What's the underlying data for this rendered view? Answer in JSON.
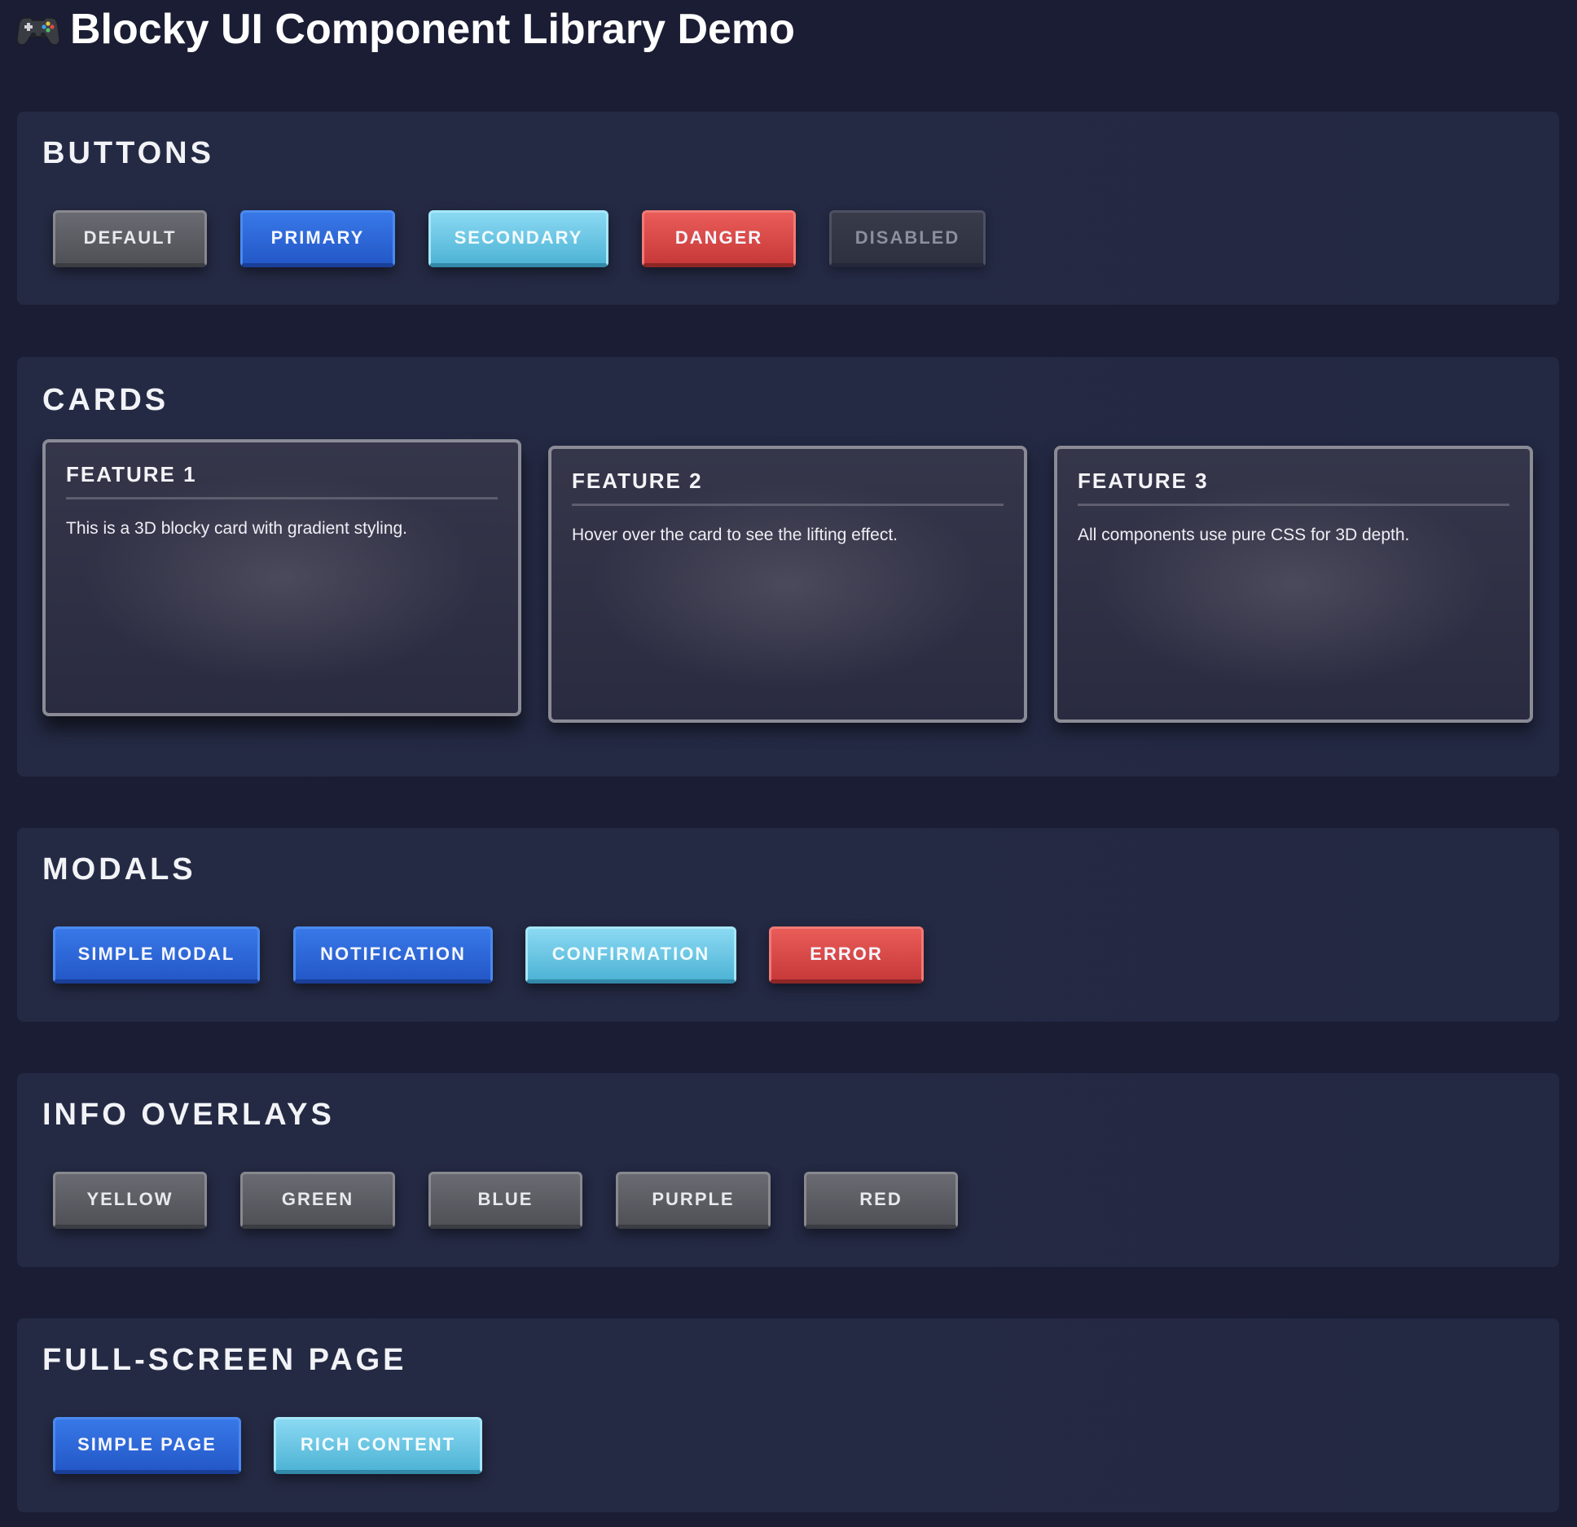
{
  "app": {
    "title": "Blocky UI Component Library Demo",
    "icon": "gamepad-icon"
  },
  "sections": {
    "buttons": {
      "title": "BUTTONS",
      "items": [
        "DEFAULT",
        "PRIMARY",
        "SECONDARY",
        "DANGER",
        "DISABLED"
      ]
    },
    "cards": {
      "title": "CARDS",
      "items": [
        {
          "title": "FEATURE 1",
          "text": "This is a 3D blocky card with gradient styling."
        },
        {
          "title": "FEATURE 2",
          "text": "Hover over the card to see the lifting effect."
        },
        {
          "title": "FEATURE 3",
          "text": "All components use pure CSS for 3D depth."
        }
      ]
    },
    "modals": {
      "title": "MODALS",
      "items": [
        "SIMPLE MODAL",
        "NOTIFICATION",
        "CONFIRMATION",
        "ERROR"
      ]
    },
    "overlays": {
      "title": "INFO OVERLAYS",
      "items": [
        "YELLOW",
        "GREEN",
        "BLUE",
        "PURPLE",
        "RED"
      ]
    },
    "fullscreen": {
      "title": "FULL-SCREEN PAGE",
      "items": [
        "SIMPLE PAGE",
        "RICH CONTENT"
      ]
    }
  },
  "colors": {
    "background": "#1a1d33",
    "panel": "#252a44",
    "default": "#5e5f66",
    "primary": "#2e67d8",
    "secondary": "#6cc8e6",
    "danger": "#d94a48",
    "disabled": "#33364a"
  }
}
